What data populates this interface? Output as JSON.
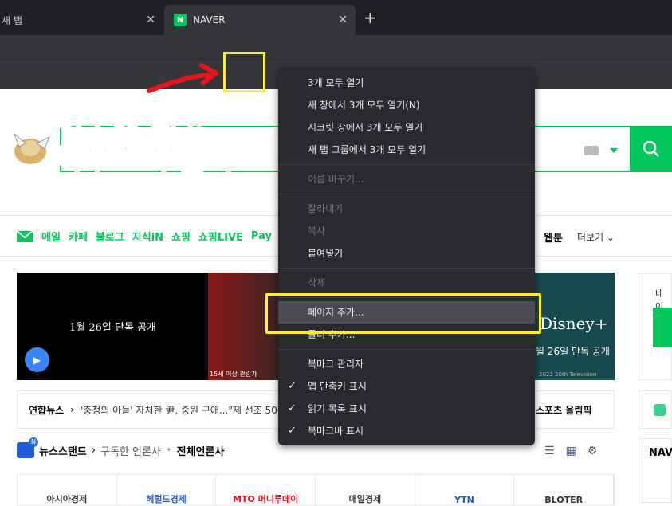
{
  "browser": {
    "tabs": [
      {
        "title": "새 탭"
      },
      {
        "title": "NAVER",
        "favicon": "N"
      }
    ],
    "new_tab_symbol": "+"
  },
  "page": {
    "nav": [
      "메일",
      "카페",
      "블로그",
      "지식iN",
      "쇼핑",
      "쇼핑LIVE",
      "Pay"
    ],
    "nav_webtoon": "웹툰",
    "nav_more": "더보기",
    "banner_left_text": "1월 26일 단독 공개",
    "banner_mid_age": "15세 이상 관람가",
    "banner_right_logo": "Disney+",
    "banner_right_date": "월 26일 단독 공개",
    "banner_right_foot": "2022 20th Television",
    "news_source": "연합뉴스",
    "news_headline": "'충청의 아들' 자처한 尹, 중원 구애...\"제 선조 500",
    "news_right": "스포츠  올림픽",
    "newsstand_title": "뉴스스탠드",
    "newsstand_subscribed": "구독한 언론사",
    "newsstand_all": "전체언론사",
    "press": [
      "아시아경제",
      "헤럴드경제",
      "MTO 머니투데이",
      "매일경제",
      "YTN",
      "BLOTER"
    ],
    "side_login_text": "네이",
    "side_3_text": "NAV"
  },
  "annotation": {
    "line1": "이곳에 대고",
    "line2": "마우스 우클릭",
    "color": "#e5141e",
    "box_color": "#ffef2a"
  },
  "context_menu": {
    "groups": [
      [
        {
          "label": "3개 모두 열기",
          "disabled": false
        },
        {
          "label": "새 창에서 3개 모두 열기(N)",
          "disabled": false
        },
        {
          "label": "시크릿 창에서 3개 모두 열기",
          "disabled": false
        },
        {
          "label": "새 탭 그룹에서 3개 모두 열기",
          "disabled": false
        }
      ],
      [
        {
          "label": "이름 바꾸기...",
          "disabled": true
        }
      ],
      [
        {
          "label": "잘라내기",
          "disabled": true
        },
        {
          "label": "복사",
          "disabled": true
        },
        {
          "label": "붙여넣기",
          "disabled": false
        }
      ],
      [
        {
          "label": "삭제",
          "disabled": true
        }
      ],
      [
        {
          "label": "페이지 추가...",
          "disabled": false,
          "highlighted": true
        },
        {
          "label": "폴더 추가...",
          "disabled": false
        }
      ],
      [
        {
          "label": "북마크 관리자",
          "disabled": false
        },
        {
          "label": "앱 단축키 표시",
          "disabled": false,
          "checked": true
        },
        {
          "label": "읽기 목록 표시",
          "disabled": false,
          "checked": true
        },
        {
          "label": "북마크바 표시",
          "disabled": false,
          "checked": true
        }
      ]
    ]
  },
  "colors": {
    "naver_green": "#03c75a",
    "menu_bg": "#292a2d",
    "chrome_dark": "#202124"
  }
}
